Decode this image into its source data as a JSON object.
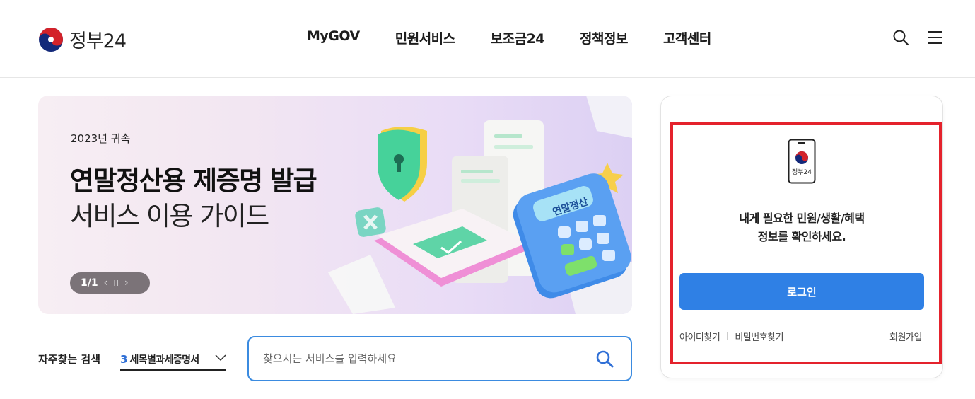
{
  "header": {
    "logo_text": "정부24",
    "nav": [
      "MyGOV",
      "민원서비스",
      "보조금24",
      "정책정보",
      "고객센터"
    ],
    "icons": [
      "search-icon",
      "hamburger-menu-icon"
    ]
  },
  "banner": {
    "subtitle": "2023년 귀속",
    "title": "연말정산용 제증명 발급",
    "title2": "서비스 이용 가이드",
    "pager": "1/1",
    "calc_label": "연말정산",
    "colors": {
      "bg_start": "#f7eef3",
      "bg_end": "#dcd0f3"
    }
  },
  "frequent_search": {
    "label": "자주찾는 검색",
    "rank": "3",
    "selected": "세목별과세증명서"
  },
  "search": {
    "placeholder": "찾으시는 서비스를 입력하세요"
  },
  "login": {
    "app_label": "정부24",
    "message_line1": "내게 필요한 민원/생활/혜택",
    "message_line2": "정보를 확인하세요.",
    "button": "로그인",
    "find_id": "아이디찾기",
    "find_pw": "비밀번호찾기",
    "signup": "회원가입",
    "accent": "#2f80e5",
    "highlight_border": "#e4222c"
  }
}
